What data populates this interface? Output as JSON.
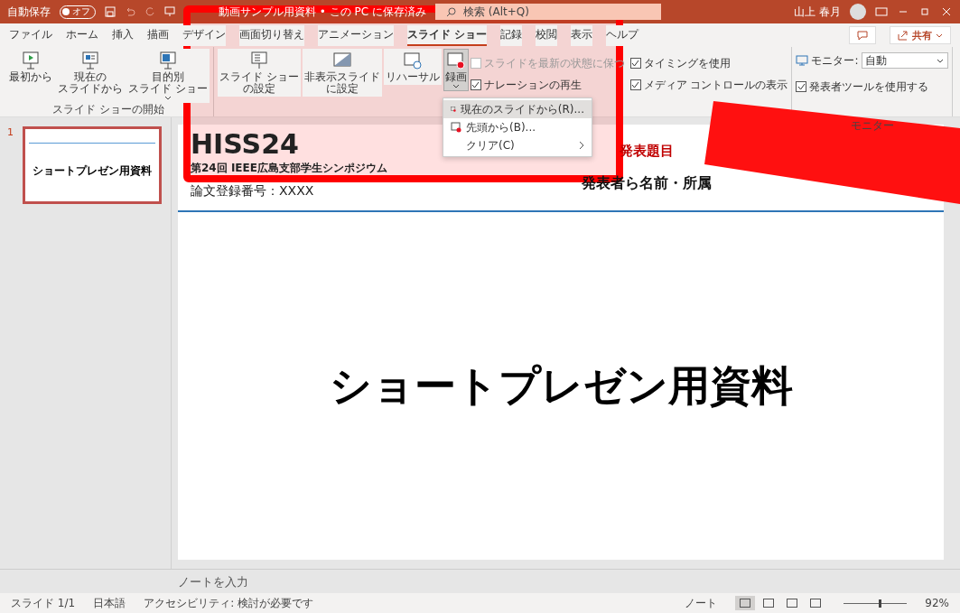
{
  "title_bar": {
    "autosave_label": "自動保存",
    "autosave": {
      "label": "オフ",
      "on": false
    },
    "document_title": "動画サンプル用資料 • この PC に保存済み",
    "search_placeholder": "検索 (Alt+Q)",
    "user_name": "山上 春月"
  },
  "tabs": [
    {
      "label": "ファイル",
      "selected": false
    },
    {
      "label": "ホーム",
      "selected": false
    },
    {
      "label": "挿入",
      "selected": false
    },
    {
      "label": "描画",
      "selected": false
    },
    {
      "label": "デザイン",
      "selected": false
    },
    {
      "label": "画面切り替え",
      "selected": false
    },
    {
      "label": "アニメーション",
      "selected": false
    },
    {
      "label": "スライド ショー",
      "selected": true
    },
    {
      "label": "記録",
      "selected": false
    },
    {
      "label": "校閲",
      "selected": false
    },
    {
      "label": "表示",
      "selected": false
    },
    {
      "label": "ヘルプ",
      "selected": false
    }
  ],
  "share_button": "共有",
  "ribbon": {
    "groups": [
      {
        "label": "スライド ショーの開始",
        "buttons": [
          {
            "label_lines": [
              "最初から"
            ],
            "dropdown": false,
            "expanded": false
          },
          {
            "label_lines": [
              "現在の",
              "スライドから"
            ],
            "dropdown": false,
            "expanded": false
          },
          {
            "label_lines": [
              "目的別",
              "スライド ショー"
            ],
            "dropdown": true,
            "expanded": false
          }
        ]
      },
      {
        "buttons": [
          {
            "label_lines": [
              "スライド ショー",
              "の設定"
            ],
            "dropdown": false,
            "expanded": false
          },
          {
            "label_lines": [
              "非表示スライド",
              "に設定"
            ],
            "dropdown": false,
            "expanded": false
          },
          {
            "label_lines": [
              "リハーサル"
            ],
            "dropdown": false,
            "expanded": false
          },
          {
            "label_lines": [
              "録画"
            ],
            "dropdown": true,
            "expanded": true
          }
        ],
        "checks": [
          {
            "label": "スライドを最新の状態に保つ",
            "checked": false,
            "disabled": true
          },
          {
            "label": "ナレーションの再生",
            "checked": true,
            "disabled": false
          },
          {
            "label": "タイミングを使用",
            "checked": true,
            "disabled": false
          },
          {
            "label": "メディア コントロールの表示",
            "checked": true,
            "disabled": false
          }
        ]
      },
      {
        "label": "モニター",
        "monitor": {
          "label": "モニター:",
          "value": "自動"
        },
        "checks": [
          {
            "label": "発表者ツールを使用する",
            "checked": true,
            "disabled": false
          }
        ]
      }
    ]
  },
  "record_menu": {
    "items": [
      {
        "kind": "record",
        "label": "現在のスライドから(R)...",
        "selected": true
      },
      {
        "kind": "record",
        "label": "先頭から(B)...",
        "selected": false
      },
      {
        "kind": "submenu",
        "label": "クリア(C)",
        "selected": false
      }
    ]
  },
  "thumbnails": [
    {
      "number": "1",
      "title": "ショートプレゼン用資料",
      "selected": true
    }
  ],
  "slide": {
    "logo": "HISS24",
    "subtitle": "第24回 IEEE広島支部学生シンポジウム",
    "paper_number": "論文登録番号：XXXX",
    "talk_title": "発表題目",
    "presenters": "発表者ら名前・所属",
    "main_title": "ショートプレゼン用資料"
  },
  "notes_placeholder": "ノートを入力",
  "status_bar": {
    "slide": "スライド 1/1",
    "language": "日本語",
    "accessibility": "アクセシビリティ: 検討が必要です",
    "notes_button": "ノート",
    "views": [
      {
        "selected": true
      },
      {
        "selected": false
      },
      {
        "selected": false
      },
      {
        "selected": false
      }
    ],
    "zoom": {
      "level": 0.55,
      "reading": "92%"
    }
  }
}
